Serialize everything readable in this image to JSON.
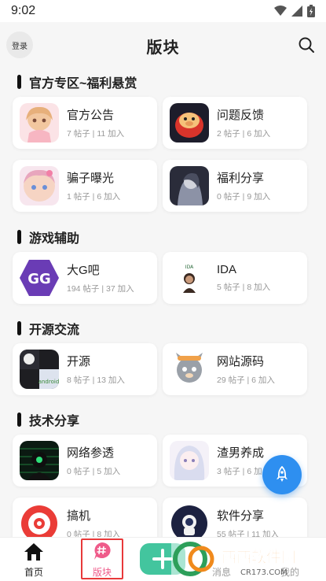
{
  "status": {
    "time": "9:02"
  },
  "header": {
    "login_label": "登录",
    "title": "版块"
  },
  "sections": [
    {
      "title": "官方专区~福利悬赏"
    },
    {
      "title": "游戏辅助"
    },
    {
      "title": "开源交流"
    },
    {
      "title": "技术分享"
    }
  ],
  "boards": [
    {
      "name": "官方公告",
      "meta": "7 帖子 | 11 加入"
    },
    {
      "name": "问题反馈",
      "meta": "2 帖子 | 6 加入"
    },
    {
      "name": "骗子曝光",
      "meta": "1 帖子 | 6 加入"
    },
    {
      "name": "福利分享",
      "meta": "0 帖子 | 9 加入"
    },
    {
      "name": "大G吧",
      "meta": "194 帖子 | 37 加入"
    },
    {
      "name": "IDA",
      "meta": "5 帖子 | 8 加入"
    },
    {
      "name": "开源",
      "meta": "8 帖子 | 13 加入"
    },
    {
      "name": "网站源码",
      "meta": "29 帖子 | 6 加入"
    },
    {
      "name": "网络参透",
      "meta": "0 帖子 | 5 加入"
    },
    {
      "name": "渣男养成",
      "meta": "3 帖子 | 6 加入"
    },
    {
      "name": "搞机",
      "meta": "0 帖子 | 8 加入"
    },
    {
      "name": "软件分享",
      "meta": "55 帖子 | 11 加入"
    }
  ],
  "thumb_text": {
    "gg": "GG",
    "ida": "IDA",
    "android": "android"
  },
  "nav": {
    "home": "首页",
    "boards": "版块",
    "messages": "消息",
    "mine": "我的"
  },
  "watermark": {
    "text": "西西软件园",
    "sub": "CR173.COM"
  },
  "colors": {
    "accent_green": "#43c59e",
    "fab_blue": "#2e8ff0",
    "active_pink": "#ef5b8a",
    "highlight_red": "#e8393a"
  }
}
